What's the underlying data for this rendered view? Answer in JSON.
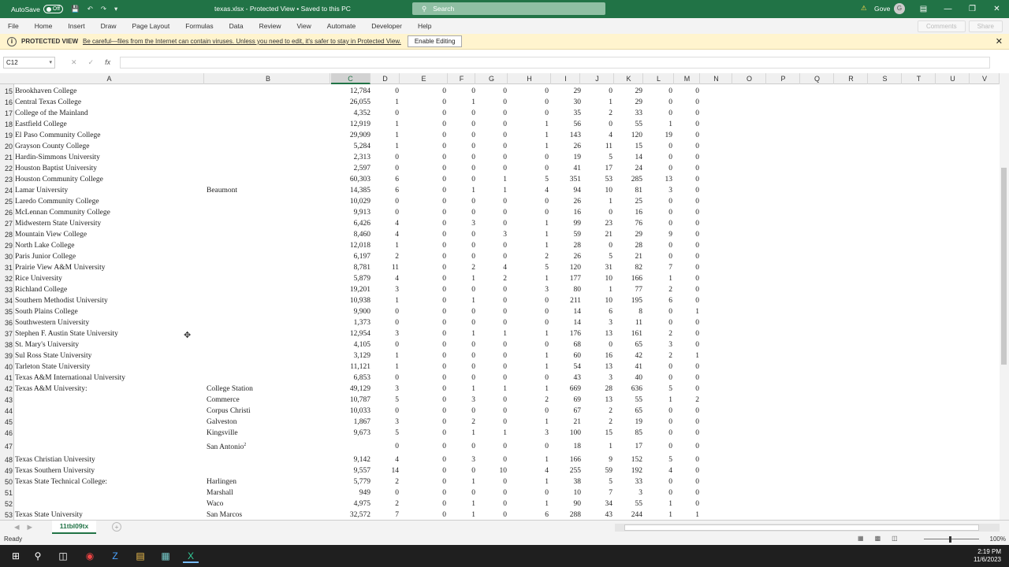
{
  "titlebar": {
    "autosave_label": "AutoSave",
    "autosave_state": "Off",
    "file_title": "texas.xlsx  -  Protected View  •  Saved to this PC",
    "search_placeholder": "Search",
    "user_name": "Gove",
    "avatar_initial": "G"
  },
  "menu": [
    "File",
    "Home",
    "Insert",
    "Draw",
    "Page Layout",
    "Formulas",
    "Data",
    "Review",
    "View",
    "Automate",
    "Developer",
    "Help"
  ],
  "menu_right": {
    "comments": "Comments",
    "share": "Share"
  },
  "protected_view": {
    "label": "PROTECTED VIEW",
    "message": "Be careful—files from the Internet can contain viruses. Unless you need to edit, it's safer to stay in Protected View.",
    "button": "Enable Editing"
  },
  "formula_bar": {
    "name_box": "C12",
    "fx": "fx",
    "value": ""
  },
  "columns": [
    "A",
    "B",
    "C",
    "D",
    "E",
    "F",
    "G",
    "H",
    "I",
    "J",
    "K",
    "L",
    "M",
    "N",
    "O",
    "P",
    "Q",
    "R",
    "S",
    "T",
    "U",
    "V"
  ],
  "selected_column": "C",
  "partial_row": {
    "num": "14",
    "a": "Baird College"
  },
  "rows": [
    {
      "n": "15",
      "a": "Brookhaven College",
      "b": "",
      "c": "12,784",
      "d": "0",
      "e": "0",
      "f": "0",
      "g": "0",
      "h": "0",
      "i": "29",
      "j": "0",
      "k": "29",
      "l": "0",
      "m": "0"
    },
    {
      "n": "16",
      "a": "Central Texas College",
      "b": "",
      "c": "26,055",
      "d": "1",
      "e": "0",
      "f": "1",
      "g": "0",
      "h": "0",
      "i": "30",
      "j": "1",
      "k": "29",
      "l": "0",
      "m": "0"
    },
    {
      "n": "17",
      "a": "College of the Mainland",
      "b": "",
      "c": "4,352",
      "d": "0",
      "e": "0",
      "f": "0",
      "g": "0",
      "h": "0",
      "i": "35",
      "j": "2",
      "k": "33",
      "l": "0",
      "m": "0"
    },
    {
      "n": "18",
      "a": "Eastfield College",
      "b": "",
      "c": "12,919",
      "d": "1",
      "e": "0",
      "f": "0",
      "g": "0",
      "h": "1",
      "i": "56",
      "j": "0",
      "k": "55",
      "l": "1",
      "m": "0"
    },
    {
      "n": "19",
      "a": "El Paso Community College",
      "b": "",
      "c": "29,909",
      "d": "1",
      "e": "0",
      "f": "0",
      "g": "0",
      "h": "1",
      "i": "143",
      "j": "4",
      "k": "120",
      "l": "19",
      "m": "0"
    },
    {
      "n": "20",
      "a": "Grayson County College",
      "b": "",
      "c": "5,284",
      "d": "1",
      "e": "0",
      "f": "0",
      "g": "0",
      "h": "1",
      "i": "26",
      "j": "11",
      "k": "15",
      "l": "0",
      "m": "0"
    },
    {
      "n": "21",
      "a": "Hardin-Simmons University",
      "b": "",
      "c": "2,313",
      "d": "0",
      "e": "0",
      "f": "0",
      "g": "0",
      "h": "0",
      "i": "19",
      "j": "5",
      "k": "14",
      "l": "0",
      "m": "0"
    },
    {
      "n": "22",
      "a": "Houston Baptist University",
      "b": "",
      "c": "2,597",
      "d": "0",
      "e": "0",
      "f": "0",
      "g": "0",
      "h": "0",
      "i": "41",
      "j": "17",
      "k": "24",
      "l": "0",
      "m": "0"
    },
    {
      "n": "23",
      "a": "Houston Community College",
      "b": "",
      "c": "60,303",
      "d": "6",
      "e": "0",
      "f": "0",
      "g": "1",
      "h": "5",
      "i": "351",
      "j": "53",
      "k": "285",
      "l": "13",
      "m": "0"
    },
    {
      "n": "24",
      "a": "Lamar University",
      "b": "Beaumont",
      "c": "14,385",
      "d": "6",
      "e": "0",
      "f": "1",
      "g": "1",
      "h": "4",
      "i": "94",
      "j": "10",
      "k": "81",
      "l": "3",
      "m": "0"
    },
    {
      "n": "25",
      "a": "Laredo Community College",
      "b": "",
      "c": "10,029",
      "d": "0",
      "e": "0",
      "f": "0",
      "g": "0",
      "h": "0",
      "i": "26",
      "j": "1",
      "k": "25",
      "l": "0",
      "m": "0"
    },
    {
      "n": "26",
      "a": "McLennan Community College",
      "b": "",
      "c": "9,913",
      "d": "0",
      "e": "0",
      "f": "0",
      "g": "0",
      "h": "0",
      "i": "16",
      "j": "0",
      "k": "16",
      "l": "0",
      "m": "0"
    },
    {
      "n": "27",
      "a": "Midwestern State University",
      "b": "",
      "c": "6,426",
      "d": "4",
      "e": "0",
      "f": "3",
      "g": "0",
      "h": "1",
      "i": "99",
      "j": "23",
      "k": "76",
      "l": "0",
      "m": "0"
    },
    {
      "n": "28",
      "a": "Mountain View College",
      "b": "",
      "c": "8,460",
      "d": "4",
      "e": "0",
      "f": "0",
      "g": "3",
      "h": "1",
      "i": "59",
      "j": "21",
      "k": "29",
      "l": "9",
      "m": "0"
    },
    {
      "n": "29",
      "a": "North Lake College",
      "b": "",
      "c": "12,018",
      "d": "1",
      "e": "0",
      "f": "0",
      "g": "0",
      "h": "1",
      "i": "28",
      "j": "0",
      "k": "28",
      "l": "0",
      "m": "0"
    },
    {
      "n": "30",
      "a": "Paris Junior College",
      "b": "",
      "c": "6,197",
      "d": "2",
      "e": "0",
      "f": "0",
      "g": "0",
      "h": "2",
      "i": "26",
      "j": "5",
      "k": "21",
      "l": "0",
      "m": "0"
    },
    {
      "n": "31",
      "a": "Prairie View A&M University",
      "b": "",
      "c": "8,781",
      "d": "11",
      "e": "0",
      "f": "2",
      "g": "4",
      "h": "5",
      "i": "120",
      "j": "31",
      "k": "82",
      "l": "7",
      "m": "0"
    },
    {
      "n": "32",
      "a": "Rice University",
      "b": "",
      "c": "5,879",
      "d": "4",
      "e": "0",
      "f": "1",
      "g": "2",
      "h": "1",
      "i": "177",
      "j": "10",
      "k": "166",
      "l": "1",
      "m": "0"
    },
    {
      "n": "33",
      "a": "Richland College",
      "b": "",
      "c": "19,201",
      "d": "3",
      "e": "0",
      "f": "0",
      "g": "0",
      "h": "3",
      "i": "80",
      "j": "1",
      "k": "77",
      "l": "2",
      "m": "0"
    },
    {
      "n": "34",
      "a": "Southern Methodist University",
      "b": "",
      "c": "10,938",
      "d": "1",
      "e": "0",
      "f": "1",
      "g": "0",
      "h": "0",
      "i": "211",
      "j": "10",
      "k": "195",
      "l": "6",
      "m": "0"
    },
    {
      "n": "35",
      "a": "South Plains College",
      "b": "",
      "c": "9,900",
      "d": "0",
      "e": "0",
      "f": "0",
      "g": "0",
      "h": "0",
      "i": "14",
      "j": "6",
      "k": "8",
      "l": "0",
      "m": "1"
    },
    {
      "n": "36",
      "a": "Southwestern University",
      "b": "",
      "c": "1,373",
      "d": "0",
      "e": "0",
      "f": "0",
      "g": "0",
      "h": "0",
      "i": "14",
      "j": "3",
      "k": "11",
      "l": "0",
      "m": "0"
    },
    {
      "n": "37",
      "a": "Stephen F. Austin State University",
      "b": "",
      "c": "12,954",
      "d": "3",
      "e": "0",
      "f": "1",
      "g": "1",
      "h": "1",
      "i": "176",
      "j": "13",
      "k": "161",
      "l": "2",
      "m": "0"
    },
    {
      "n": "38",
      "a": "St. Mary's University",
      "b": "",
      "c": "4,105",
      "d": "0",
      "e": "0",
      "f": "0",
      "g": "0",
      "h": "0",
      "i": "68",
      "j": "0",
      "k": "65",
      "l": "3",
      "m": "0"
    },
    {
      "n": "39",
      "a": "Sul Ross State University",
      "b": "",
      "c": "3,129",
      "d": "1",
      "e": "0",
      "f": "0",
      "g": "0",
      "h": "1",
      "i": "60",
      "j": "16",
      "k": "42",
      "l": "2",
      "m": "1"
    },
    {
      "n": "40",
      "a": "Tarleton State University",
      "b": "",
      "c": "11,121",
      "d": "1",
      "e": "0",
      "f": "0",
      "g": "0",
      "h": "1",
      "i": "54",
      "j": "13",
      "k": "41",
      "l": "0",
      "m": "0"
    },
    {
      "n": "41",
      "a": "Texas A&M International University",
      "b": "",
      "c": "6,853",
      "d": "0",
      "e": "0",
      "f": "0",
      "g": "0",
      "h": "0",
      "i": "43",
      "j": "3",
      "k": "40",
      "l": "0",
      "m": "0"
    },
    {
      "n": "42",
      "a": "Texas A&M University:",
      "b": "College Station",
      "c": "49,129",
      "d": "3",
      "e": "0",
      "f": "1",
      "g": "1",
      "h": "1",
      "i": "669",
      "j": "28",
      "k": "636",
      "l": "5",
      "m": "0"
    },
    {
      "n": "43",
      "a": "",
      "b": "Commerce",
      "c": "10,787",
      "d": "5",
      "e": "0",
      "f": "3",
      "g": "0",
      "h": "2",
      "i": "69",
      "j": "13",
      "k": "55",
      "l": "1",
      "m": "2"
    },
    {
      "n": "44",
      "a": "",
      "b": "Corpus Christi",
      "c": "10,033",
      "d": "0",
      "e": "0",
      "f": "0",
      "g": "0",
      "h": "0",
      "i": "67",
      "j": "2",
      "k": "65",
      "l": "0",
      "m": "0"
    },
    {
      "n": "45",
      "a": "",
      "b": "Galveston",
      "c": "1,867",
      "d": "3",
      "e": "0",
      "f": "2",
      "g": "0",
      "h": "1",
      "i": "21",
      "j": "2",
      "k": "19",
      "l": "0",
      "m": "0"
    },
    {
      "n": "46",
      "a": "",
      "b": "Kingsville",
      "c": "9,673",
      "d": "5",
      "e": "0",
      "f": "1",
      "g": "1",
      "h": "3",
      "i": "100",
      "j": "15",
      "k": "85",
      "l": "0",
      "m": "0"
    },
    {
      "n": "47",
      "a": "",
      "b": "San Antonio",
      "sup": "2",
      "c": "",
      "d": "0",
      "e": "0",
      "f": "0",
      "g": "0",
      "h": "0",
      "i": "18",
      "j": "1",
      "k": "17",
      "l": "0",
      "m": "0"
    },
    {
      "n": "48",
      "a": "Texas Christian University",
      "b": "",
      "c": "9,142",
      "d": "4",
      "e": "0",
      "f": "3",
      "g": "0",
      "h": "1",
      "i": "166",
      "j": "9",
      "k": "152",
      "l": "5",
      "m": "0"
    },
    {
      "n": "49",
      "a": "Texas Southern University",
      "b": "",
      "c": "9,557",
      "d": "14",
      "e": "0",
      "f": "0",
      "g": "10",
      "h": "4",
      "i": "255",
      "j": "59",
      "k": "192",
      "l": "4",
      "m": "0"
    },
    {
      "n": "50",
      "a": "Texas State Technical College:",
      "b": "Harlingen",
      "c": "5,779",
      "d": "2",
      "e": "0",
      "f": "1",
      "g": "0",
      "h": "1",
      "i": "38",
      "j": "5",
      "k": "33",
      "l": "0",
      "m": "0"
    },
    {
      "n": "51",
      "a": "",
      "b": "Marshall",
      "c": "949",
      "d": "0",
      "e": "0",
      "f": "0",
      "g": "0",
      "h": "0",
      "i": "10",
      "j": "7",
      "k": "3",
      "l": "0",
      "m": "0"
    },
    {
      "n": "52",
      "a": "",
      "b": "Waco",
      "c": "4,975",
      "d": "2",
      "e": "0",
      "f": "1",
      "g": "0",
      "h": "1",
      "i": "90",
      "j": "34",
      "k": "55",
      "l": "1",
      "m": "0"
    },
    {
      "n": "53",
      "a": "Texas State University",
      "b": "San Marcos",
      "c": "32,572",
      "d": "7",
      "e": "0",
      "f": "1",
      "g": "0",
      "h": "6",
      "i": "288",
      "j": "43",
      "k": "244",
      "l": "1",
      "m": "1"
    }
  ],
  "sheet_tab": "11tbl09tx",
  "status": {
    "ready": "Ready",
    "zoom": "100%"
  },
  "clock": {
    "time": "2:19 PM",
    "date": "11/6/2023"
  },
  "colors": {
    "excel_green": "#217346",
    "protected_bar": "#fff4ce"
  }
}
